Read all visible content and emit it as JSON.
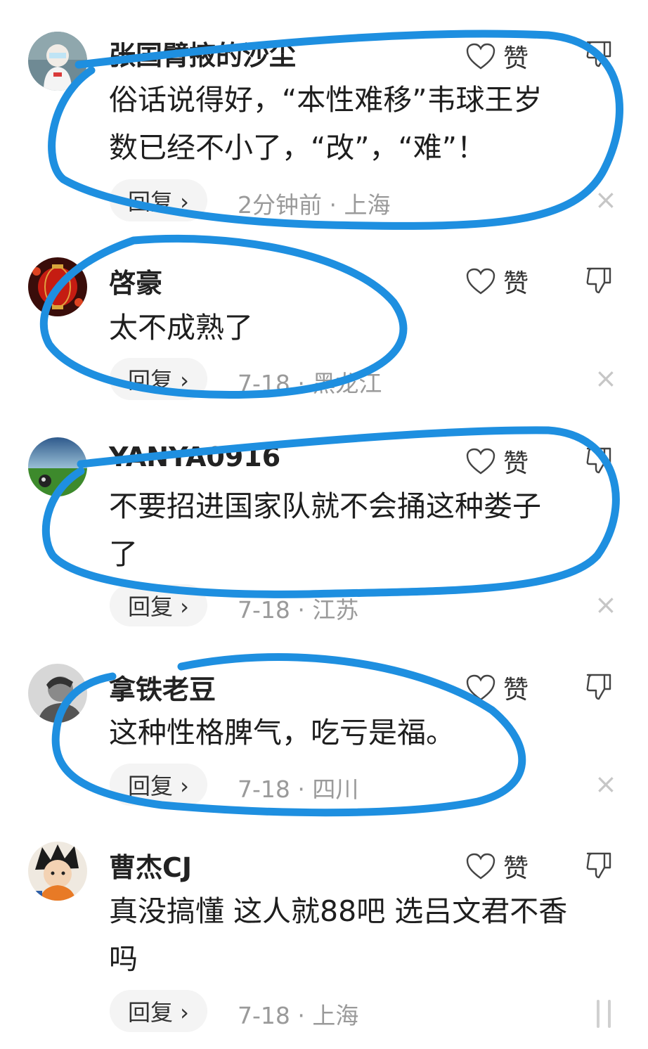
{
  "ui": {
    "like_label": "赞",
    "reply_label": "回复 ›",
    "close_glyph": "×"
  },
  "colors": {
    "annotation_stroke": "#1e8fe0",
    "meta_text": "#9a9a9a"
  },
  "comments": [
    {
      "username": "张国臂掖的沙尘",
      "avatar_icon": "doctor-figure-avatar",
      "text_lines": [
        "俗话说得好，“本性难移”韦球王岁",
        "数已经不小了，“改”，“难”！"
      ],
      "meta": "2分钟前 · 上海"
    },
    {
      "username": "啓豪",
      "avatar_icon": "red-lantern-avatar",
      "text_lines": [
        "太不成熟了"
      ],
      "meta": "7-18 · 黑龙江"
    },
    {
      "username": "YANYA0916",
      "avatar_icon": "football-field-avatar",
      "text_lines": [
        "不要招进国家队就不会捅这种娄子",
        "了"
      ],
      "meta": "7-18 · 江苏"
    },
    {
      "username": "拿铁老豆",
      "avatar_icon": "grayscale-portrait-avatar",
      "text_lines": [
        "这种性格脾气，吃亏是福。"
      ],
      "meta": "7-18 · 四川"
    },
    {
      "username": "曹杰CJ",
      "avatar_icon": "anime-character-avatar",
      "text_lines": [
        "真没搞懂 这人就88吧 选吕文君不香",
        "吗"
      ],
      "meta": "7-18 · 上海"
    }
  ]
}
